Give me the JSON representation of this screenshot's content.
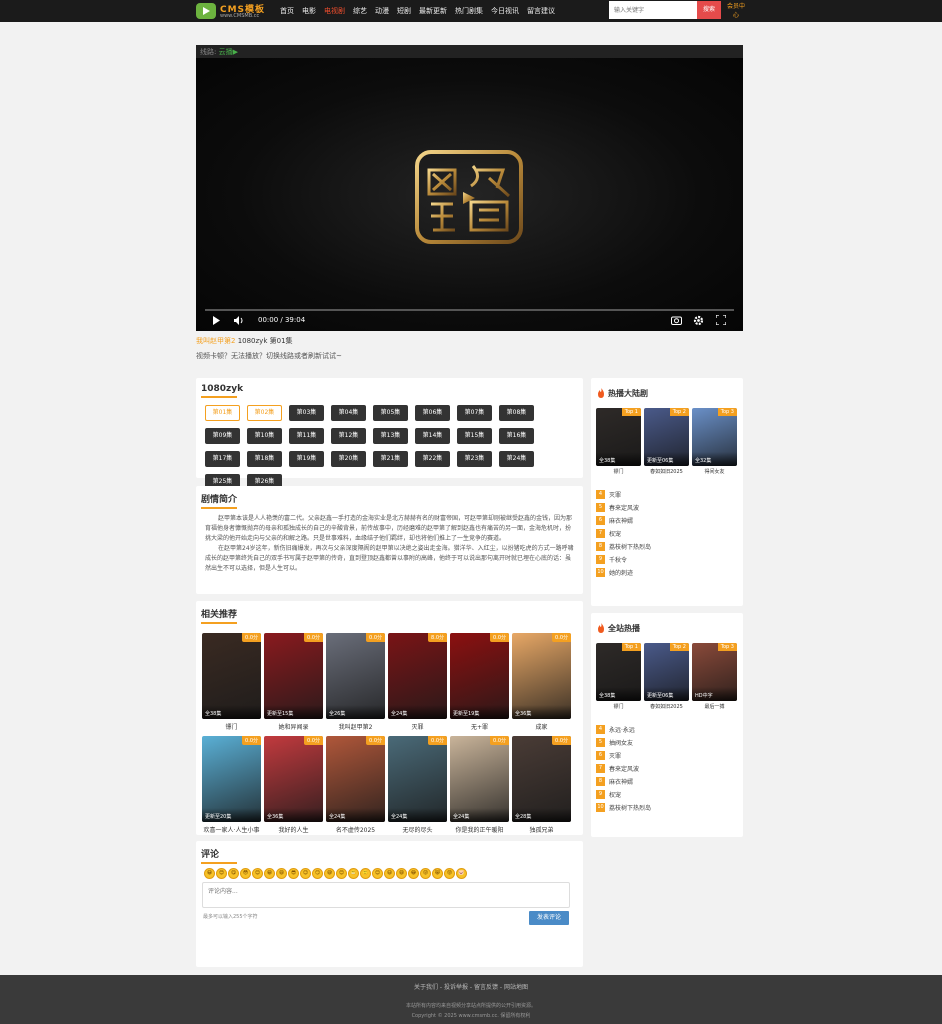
{
  "header": {
    "logo_main": "CMS模板",
    "logo_sub": "www.CMSMB.cc",
    "nav": [
      "首页",
      "电影",
      "电视剧",
      "综艺",
      "动漫",
      "短剧",
      "最新更新",
      "热门剧集",
      "今日视讯",
      "留言建议"
    ],
    "active_nav": 2,
    "search_placeholder": "输入关键字",
    "search_button": "搜索",
    "member_label": "会员中心"
  },
  "player": {
    "line_label": "线路:",
    "line_name": "云播▶",
    "time": "00:00 / 39:04",
    "progress": 0,
    "now_playing_title": "我叫赵甲第2",
    "now_playing_source": " 1080zyk",
    "now_playing_episode": " 第01集",
    "hint": "视频卡顿？无法播放？切换线路或者刷新试试~"
  },
  "episodes": {
    "title": "1080zyk",
    "items": [
      "第01集",
      "第02集",
      "第03集",
      "第04集",
      "第05集",
      "第06集",
      "第07集",
      "第08集",
      "第09集",
      "第10集",
      "第11集",
      "第12集",
      "第13集",
      "第14集",
      "第15集",
      "第16集",
      "第17集",
      "第18集",
      "第19集",
      "第20集",
      "第21集",
      "第22集",
      "第23集",
      "第24集",
      "第25集",
      "第26集"
    ],
    "watched": [
      0,
      1
    ]
  },
  "synopsis": {
    "title": "剧情简介",
    "paragraphs": [
      "赵甲第本该是人人艳羡的富二代。父亲赵鑫一手打造的金海实业是北方赫赫有名的财富帝国，可赵甲第却刚被继受赵鑫的金钱，因为那育福他身者慷慨抛弃的母亲和孤独成长的自己的辛酸背景，前传故事中，历经磨难的赵甲第了解到赵鑫也有痛苦的另一面，金海危机时，扮挑大梁的他开始走向与父亲的和解之路。只是世事难料，血缘结子他们羁绊，却也将他们推上了一生竞争的赛道。",
      "在赵甲第24岁这年，新伤旧痛爆发，再次与父亲深度隔阂的赵甲第以决绝之姿出走金海。猎洋华、入红尘，以扮猪吃虎的方式一路呼啸成长的赵甲第终凭自己的双手书写属于赵甲第的传奇，直到登顶赵鑫都曾以事附的高峰，他终于可以说出那句离开时就已埋在心底的话：虽然出生不可以选择，但是人生可以。"
    ]
  },
  "recommend": {
    "title": "相关推荐",
    "items": [
      {
        "title": "镖门",
        "score": "0.0分",
        "tag": "全38集",
        "color": "#3a2a22"
      },
      {
        "title": "她和异闻录",
        "score": "0.0分",
        "tag": "更新至15集",
        "color": "#8a1a1e"
      },
      {
        "title": "我叫赵甲第2",
        "score": "0.0分",
        "tag": "全26集",
        "color": "#6a6e7a"
      },
      {
        "title": "灭罪",
        "score": "8.0分",
        "tag": "全24集",
        "color": "#7a1416"
      },
      {
        "title": "无+罪",
        "score": "0.0分",
        "tag": "更新至19集",
        "color": "#8c1010"
      },
      {
        "title": "成家",
        "score": "0.0分",
        "tag": "全36集",
        "color": "#e8a866"
      },
      {
        "title": "欢喜一家人·人生小事",
        "score": "0.0分",
        "tag": "更新至20集",
        "color": "#5ab0d6"
      },
      {
        "title": "我好的人生",
        "score": "0.0分",
        "tag": "全36集",
        "color": "#c23a3e"
      },
      {
        "title": "名不虚传2025",
        "score": "0.0分",
        "tag": "全24集",
        "color": "#b0573a"
      },
      {
        "title": "无尽的尽头",
        "score": "0.0分",
        "tag": "全24集",
        "color": "#4a6a78"
      },
      {
        "title": "你是我的正午暖阳",
        "score": "0.0分",
        "tag": "全24集",
        "color": "#c9b49a"
      },
      {
        "title": "独孤兄弟",
        "score": "0.0分",
        "tag": "全28集",
        "color": "#4a3c36"
      }
    ]
  },
  "comment": {
    "title": "评论",
    "emoji": [
      "😀",
      "😍",
      "😋",
      "😳",
      "😊",
      "😁",
      "😄",
      "😎",
      "😉",
      "😏",
      "😅",
      "😌",
      "😬",
      "🙂",
      "😊",
      "😃",
      "😆",
      "😂",
      "😜",
      "😸",
      "😝",
      "🐷"
    ],
    "placeholder": "评论内容...",
    "note": "最多可以输入255个字符",
    "submit": "发表评论"
  },
  "sidebar_hot_drama": {
    "title": "热播大陆剧",
    "top": [
      {
        "title": "镖门",
        "badge": "Top 1",
        "tag": "全38集",
        "color": "#2e2a28"
      },
      {
        "title": "春如如旧2025",
        "badge": "Top 2",
        "tag": "更新至06集",
        "color": "#4a5a8a"
      },
      {
        "title": "得间女友",
        "badge": "Top 3",
        "tag": "全32集",
        "color": "#6a90c8"
      }
    ],
    "list": [
      {
        "rank": "4",
        "title": "灭罪"
      },
      {
        "rank": "5",
        "title": "春来定风波"
      },
      {
        "rank": "6",
        "title": "麻衣神婿"
      },
      {
        "rank": "7",
        "title": "权宠"
      },
      {
        "rank": "8",
        "title": "荔枝树下热烈岛"
      },
      {
        "rank": "9",
        "title": "千秋令"
      },
      {
        "rank": "10",
        "title": "她的刺迹"
      }
    ]
  },
  "sidebar_site_hot": {
    "title": "全站热播",
    "top": [
      {
        "title": "镖门",
        "badge": "Top 1",
        "tag": "全38集",
        "color": "#2e2a28"
      },
      {
        "title": "春如如旧2025",
        "badge": "Top 2",
        "tag": "更新至06集",
        "color": "#4a5a8a"
      },
      {
        "title": "最后一搏",
        "badge": "Top 3",
        "tag": "HD中字",
        "color": "#8a4a3a"
      }
    ],
    "list": [
      {
        "rank": "4",
        "title": "永远·永远"
      },
      {
        "rank": "5",
        "title": "抽阀女友"
      },
      {
        "rank": "6",
        "title": "灭罪"
      },
      {
        "rank": "7",
        "title": "春来定风波"
      },
      {
        "rank": "8",
        "title": "麻衣神婿"
      },
      {
        "rank": "9",
        "title": "权宠"
      },
      {
        "rank": "10",
        "title": "荔枝树下热烈岛"
      }
    ]
  },
  "footer": {
    "links": "关于我们 - 投诉举报 - 留言反馈 - 网站地图",
    "note": "本站所有内容均来自视频分享站点所提供的公开引用资源。",
    "copyright": "Copyright © 2025 www.cmsmb.cc. 保留所有权利"
  },
  "colors": {
    "accent": "#f4a020",
    "header_bg": "#1b1b1b",
    "search_button": "#e54b4b",
    "submit_button": "#4a8bc7"
  }
}
